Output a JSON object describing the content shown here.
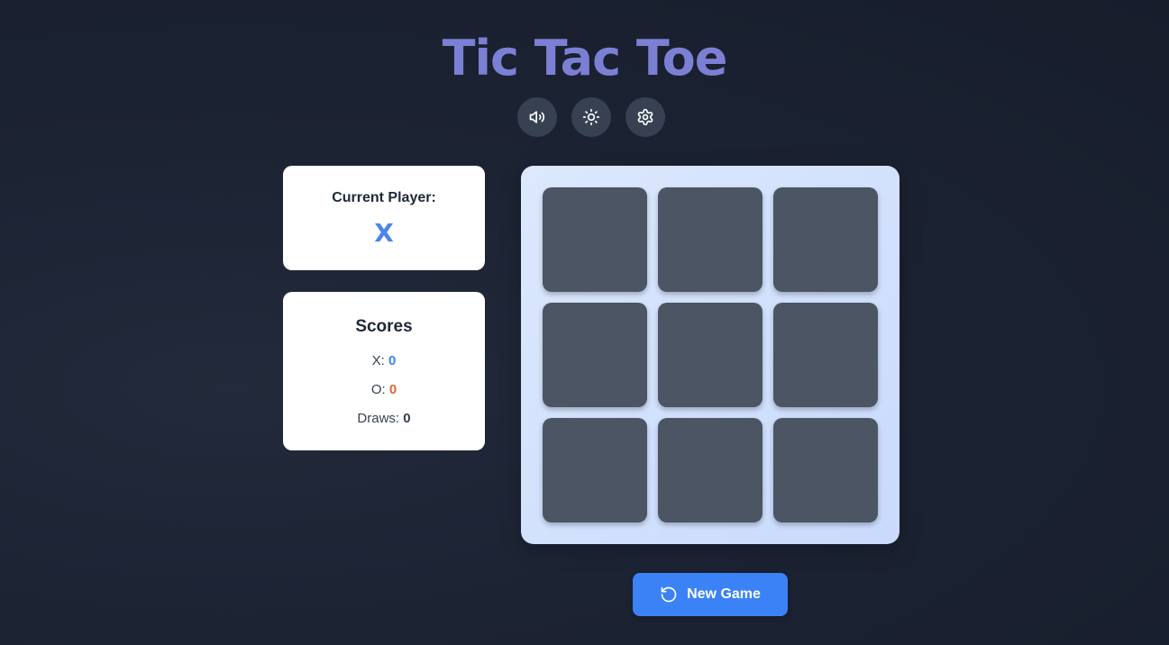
{
  "app": {
    "title": "Tic Tac Toe"
  },
  "toolbar": {
    "buttons": [
      {
        "icon": "volume-icon"
      },
      {
        "icon": "sun-icon"
      },
      {
        "icon": "gear-icon"
      }
    ]
  },
  "player_card": {
    "label": "Current Player:",
    "current": "X"
  },
  "scores": {
    "title": "Scores",
    "x_label": "X:",
    "x_value": "0",
    "o_label": "O:",
    "o_value": "0",
    "draws_label": "Draws:",
    "draws_value": "0"
  },
  "board": {
    "cells": [
      "",
      "",
      "",
      "",
      "",
      "",
      "",
      "",
      ""
    ]
  },
  "actions": {
    "new_game_label": "New Game",
    "new_game_icon": "restart-icon"
  },
  "colors": {
    "title": "#7b80d4",
    "accent": "#3b82f6",
    "x_color": "#3b82f6",
    "o_color": "#e0633a",
    "cell": "#4b5563",
    "board": "#d3e2fd"
  }
}
